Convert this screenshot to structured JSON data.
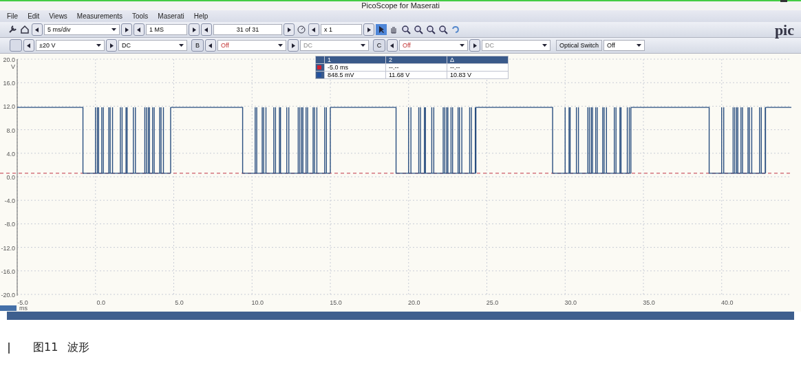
{
  "window": {
    "title": "PicoScope for Maserati"
  },
  "menu": [
    "File",
    "Edit",
    "Views",
    "Measurements",
    "Tools",
    "Maserati",
    "Help"
  ],
  "toolbar": {
    "timebase": "5 ms/div",
    "samples": "1 MS",
    "buffer": "31 of 31",
    "zoom": "x 1"
  },
  "channels": [
    {
      "range": "±20 V",
      "coupling": "DC",
      "enabled": true
    },
    {
      "channel": "B",
      "range": "Off",
      "coupling": "DC",
      "enabled": false
    },
    {
      "channel": "C",
      "range": "Off",
      "coupling": "DC",
      "enabled": false
    }
  ],
  "optical_switch": {
    "label": "Optical Switch",
    "value": "Off"
  },
  "logo": "pic",
  "measurements": {
    "columns": [
      "1",
      "2",
      "Δ"
    ],
    "rows": [
      {
        "color": "#d02030",
        "cells": [
          "-5.0 ms",
          "--.--",
          "--.--"
        ]
      },
      {
        "color": "#2050a0",
        "cells": [
          "848.5 mV",
          "11.68 V",
          "10.83 V"
        ]
      }
    ]
  },
  "plot": {
    "y_unit": "V",
    "y_ticks": [
      "20.0",
      "16.0",
      "12.0",
      "8.0",
      "4.0",
      "0.0",
      "-4.0",
      "-8.0",
      "-12.0",
      "-16.0",
      "-20.0"
    ],
    "x_unit": "ms",
    "x_ticks": [
      "-5.0",
      "0.0",
      "5.0",
      "10.0",
      "15.0",
      "20.0",
      "25.0",
      "30.0",
      "35.0",
      "40.0"
    ]
  },
  "caption": {
    "figure": "图11",
    "title": "波形"
  }
}
